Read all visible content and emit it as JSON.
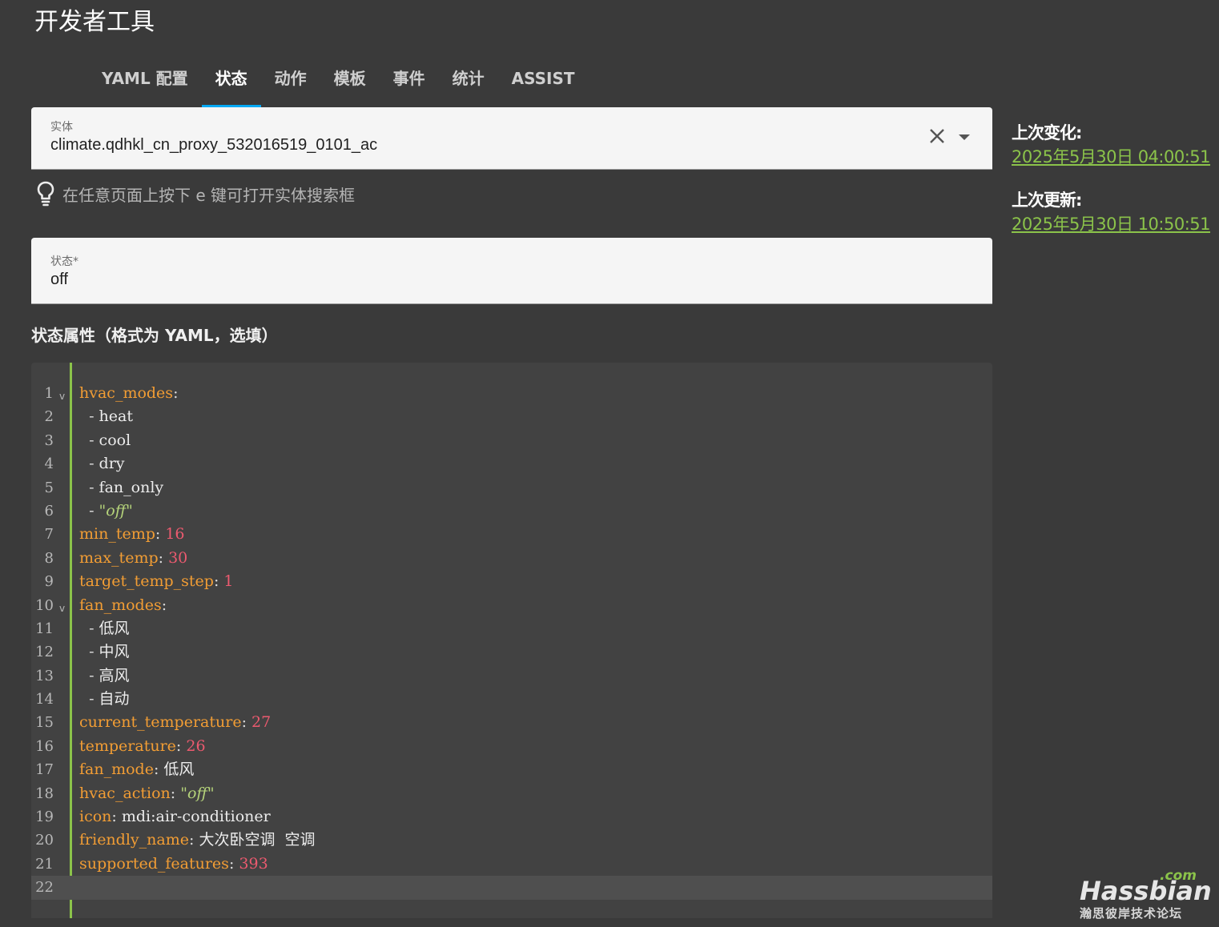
{
  "header": {
    "title": "开发者工具"
  },
  "tabs": [
    {
      "label": "YAML 配置",
      "active": false
    },
    {
      "label": "状态",
      "active": true
    },
    {
      "label": "动作",
      "active": false
    },
    {
      "label": "模板",
      "active": false
    },
    {
      "label": "事件",
      "active": false
    },
    {
      "label": "统计",
      "active": false
    },
    {
      "label": "ASSIST",
      "active": false
    }
  ],
  "entity": {
    "label": "实体",
    "value": "climate.qdhkl_cn_proxy_532016519_0101_ac",
    "clear_icon": "close-icon",
    "dropdown_icon": "arrow-drop-down-icon"
  },
  "hint": {
    "icon": "lightbulb-outline-icon",
    "text": "在任意页面上按下 e 键可打开实体搜索框"
  },
  "state": {
    "label": "状态*",
    "value": "off"
  },
  "attributes": {
    "heading": "状态属性（格式为 YAML，选填）",
    "lines": [
      {
        "ln": "1",
        "fold": true,
        "parts": [
          [
            "k",
            "hvac_modes"
          ],
          [
            "p",
            ":"
          ]
        ]
      },
      {
        "ln": "2",
        "parts": [
          [
            "p",
            "  - "
          ],
          [
            "t",
            "heat"
          ]
        ]
      },
      {
        "ln": "3",
        "parts": [
          [
            "p",
            "  - "
          ],
          [
            "t",
            "cool"
          ]
        ]
      },
      {
        "ln": "4",
        "parts": [
          [
            "p",
            "  - "
          ],
          [
            "t",
            "dry"
          ]
        ]
      },
      {
        "ln": "5",
        "parts": [
          [
            "p",
            "  - "
          ],
          [
            "t",
            "fan_only"
          ]
        ]
      },
      {
        "ln": "6",
        "parts": [
          [
            "p",
            "  - "
          ],
          [
            "s",
            "\"off\""
          ]
        ]
      },
      {
        "ln": "7",
        "parts": [
          [
            "k",
            "min_temp"
          ],
          [
            "p",
            ": "
          ],
          [
            "n",
            "16"
          ]
        ]
      },
      {
        "ln": "8",
        "parts": [
          [
            "k",
            "max_temp"
          ],
          [
            "p",
            ": "
          ],
          [
            "n",
            "30"
          ]
        ]
      },
      {
        "ln": "9",
        "parts": [
          [
            "k",
            "target_temp_step"
          ],
          [
            "p",
            ": "
          ],
          [
            "n",
            "1"
          ]
        ]
      },
      {
        "ln": "10",
        "fold": true,
        "parts": [
          [
            "k",
            "fan_modes"
          ],
          [
            "p",
            ":"
          ]
        ]
      },
      {
        "ln": "11",
        "parts": [
          [
            "p",
            "  - "
          ],
          [
            "t",
            "低风"
          ]
        ]
      },
      {
        "ln": "12",
        "parts": [
          [
            "p",
            "  - "
          ],
          [
            "t",
            "中风"
          ]
        ]
      },
      {
        "ln": "13",
        "parts": [
          [
            "p",
            "  - "
          ],
          [
            "t",
            "高风"
          ]
        ]
      },
      {
        "ln": "14",
        "parts": [
          [
            "p",
            "  - "
          ],
          [
            "t",
            "自动"
          ]
        ]
      },
      {
        "ln": "15",
        "parts": [
          [
            "k",
            "current_temperature"
          ],
          [
            "p",
            ": "
          ],
          [
            "n",
            "27"
          ]
        ]
      },
      {
        "ln": "16",
        "parts": [
          [
            "k",
            "temperature"
          ],
          [
            "p",
            ": "
          ],
          [
            "n",
            "26"
          ]
        ]
      },
      {
        "ln": "17",
        "parts": [
          [
            "k",
            "fan_mode"
          ],
          [
            "p",
            ": "
          ],
          [
            "t",
            "低风"
          ]
        ]
      },
      {
        "ln": "18",
        "parts": [
          [
            "k",
            "hvac_action"
          ],
          [
            "p",
            ": "
          ],
          [
            "s",
            "\"off\""
          ]
        ]
      },
      {
        "ln": "19",
        "parts": [
          [
            "k",
            "icon"
          ],
          [
            "p",
            ": "
          ],
          [
            "t",
            "mdi:air-conditioner"
          ]
        ]
      },
      {
        "ln": "20",
        "parts": [
          [
            "k",
            "friendly_name"
          ],
          [
            "p",
            ": "
          ],
          [
            "t",
            "大次卧空调  空调"
          ]
        ]
      },
      {
        "ln": "21",
        "parts": [
          [
            "k",
            "supported_features"
          ],
          [
            "p",
            ": "
          ],
          [
            "n",
            "393"
          ]
        ]
      },
      {
        "ln": "22",
        "active": true,
        "parts": []
      }
    ]
  },
  "sidebar": {
    "last_changed_label": "上次变化:",
    "last_changed_value": "2025年5月30日 04:00:51",
    "last_updated_label": "上次更新:",
    "last_updated_value": "2025年5月30日 10:50:51"
  },
  "watermark": {
    "main": "Hassbian",
    "com": ".com",
    "sub": "瀚思彼岸技术论坛"
  },
  "colors": {
    "background": "#3a3a3a",
    "accent": "#8bc34a",
    "tab_indicator": "#03a9f4",
    "yaml_key": "#f29d34",
    "yaml_number": "#ec5a6f",
    "yaml_string": "#b5d37a"
  }
}
